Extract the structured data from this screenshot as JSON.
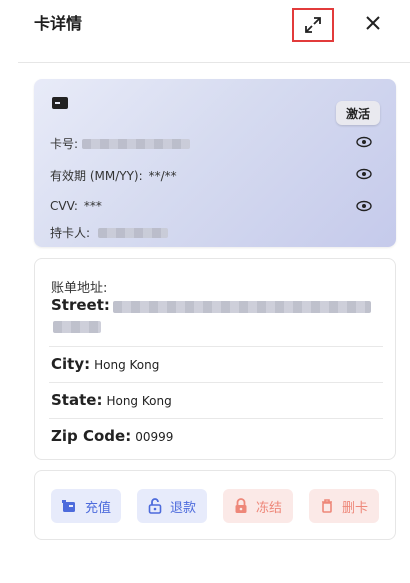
{
  "header": {
    "title": "卡详情"
  },
  "card": {
    "activate_label": "激活",
    "card_number_label": "卡号:",
    "expiry_label": "有效期 (MM/YY):",
    "expiry_value": "**/**",
    "cvv_label": "CVV:",
    "cvv_value": "***",
    "holder_label": "持卡人:"
  },
  "billing": {
    "label": "账单地址:",
    "street_label": "Street:",
    "city_label": "City:",
    "city_value": "Hong Kong",
    "state_label": "State:",
    "state_value": "Hong Kong",
    "zip_label": "Zip Code:",
    "zip_value": "00999"
  },
  "actions": {
    "recharge": "充值",
    "refund": "退款",
    "freeze": "冻结",
    "delete": "删卡"
  },
  "colors": {
    "accent_blue": "#4d6bdc",
    "danger": "#ee8779",
    "highlight_border": "#e23b3b"
  }
}
